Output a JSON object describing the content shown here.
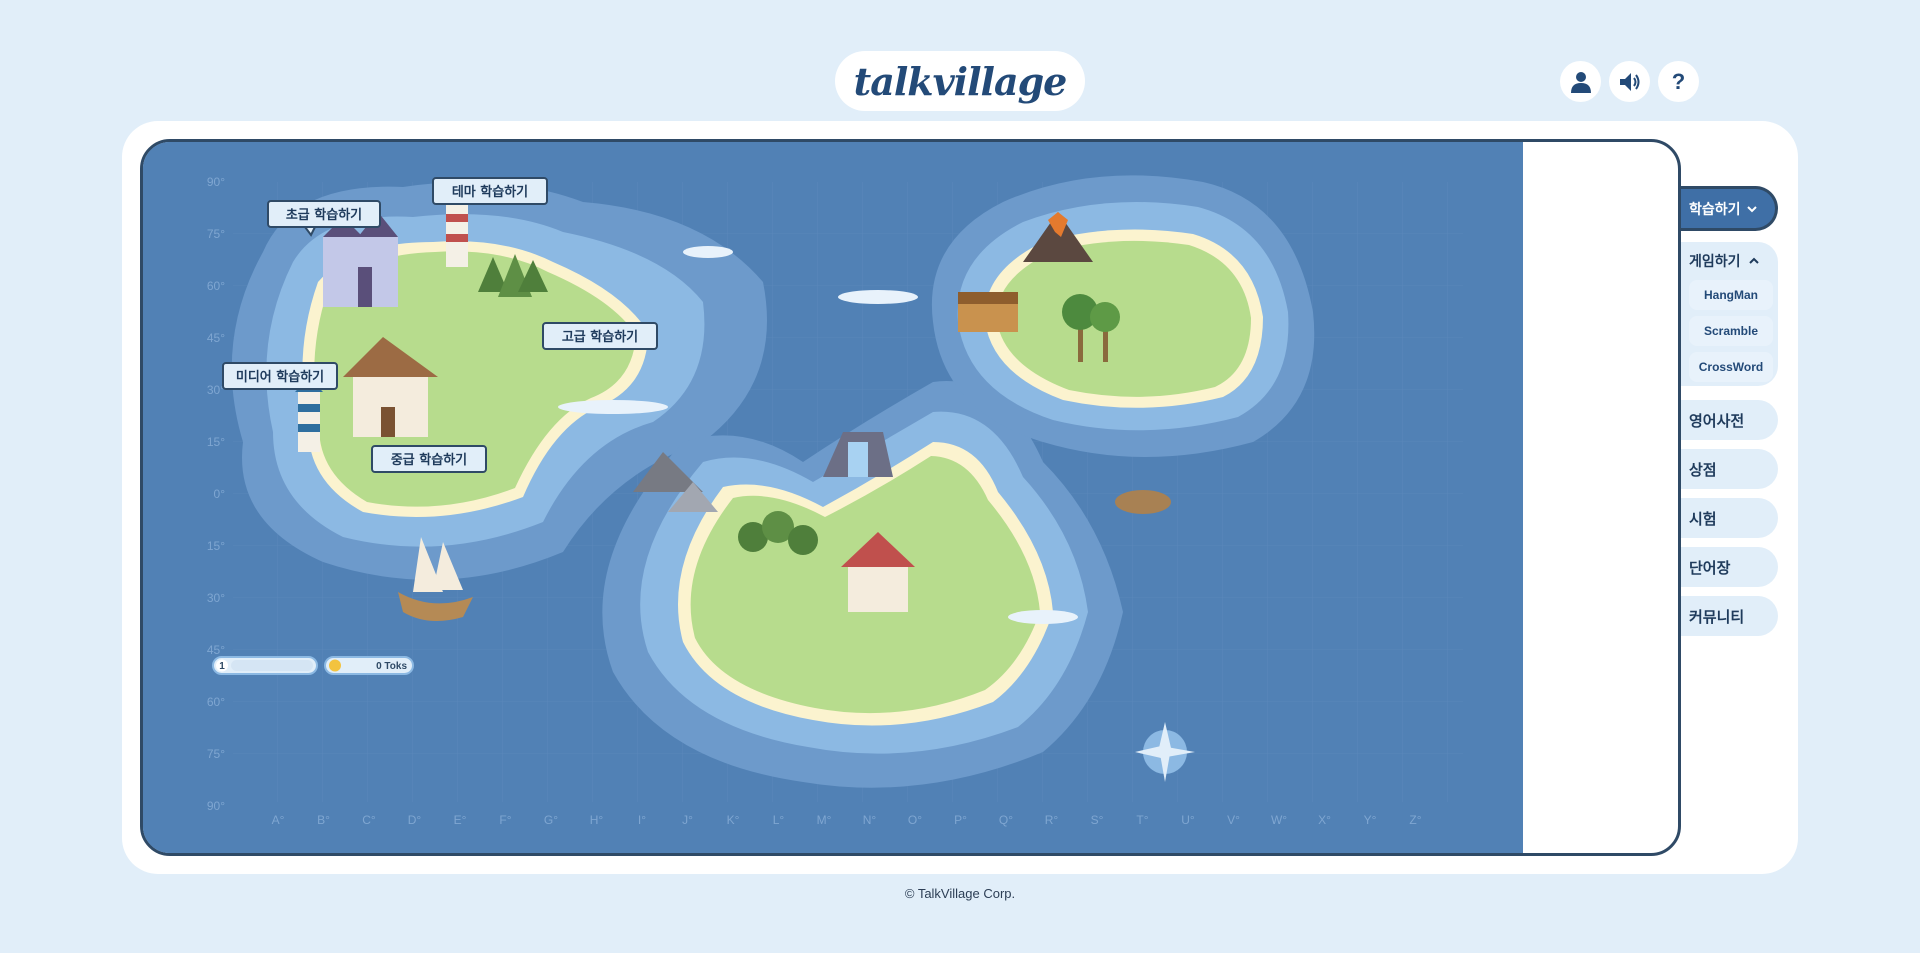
{
  "header": {
    "logo_text": "talkvillage",
    "icons": [
      "user-icon",
      "speaker-icon",
      "help-icon"
    ],
    "help_label": "?"
  },
  "map": {
    "lat_labels": [
      "90°",
      "75°",
      "60°",
      "45°",
      "30°",
      "15°",
      "0°",
      "15°",
      "30°",
      "45°",
      "60°",
      "75°",
      "90°"
    ],
    "lon_labels": [
      "A°",
      "B°",
      "C°",
      "D°",
      "E°",
      "F°",
      "G°",
      "H°",
      "I°",
      "J°",
      "K°",
      "L°",
      "M°",
      "N°",
      "O°",
      "P°",
      "Q°",
      "R°",
      "S°",
      "T°",
      "U°",
      "V°",
      "W°",
      "X°",
      "Y°",
      "Z°"
    ],
    "places": {
      "beginner": "초급 학습하기",
      "theme": "테마 학습하기",
      "advanced": "고급 학습하기",
      "media": "미디어 학습하기",
      "intermediate": "중급 학습하기"
    },
    "hud": {
      "level": "1",
      "level_progress": 0,
      "coins": "0 Toks"
    }
  },
  "menu": {
    "active": "학습하기",
    "game": {
      "label": "게임하기",
      "items": [
        "HangMan",
        "Scramble",
        "CrossWord"
      ]
    },
    "items": [
      "영어사전",
      "상점",
      "시험",
      "단어장",
      "커뮤니티"
    ]
  },
  "footer": "© TalkVillage Corp.",
  "colors": {
    "ocean": "#5181b5",
    "shallow": "#8cb9e3",
    "land": "#b7dc8d",
    "sand": "#fbf3cf",
    "accent": "#3f6fa6",
    "page_bg": "#e1eef9"
  }
}
